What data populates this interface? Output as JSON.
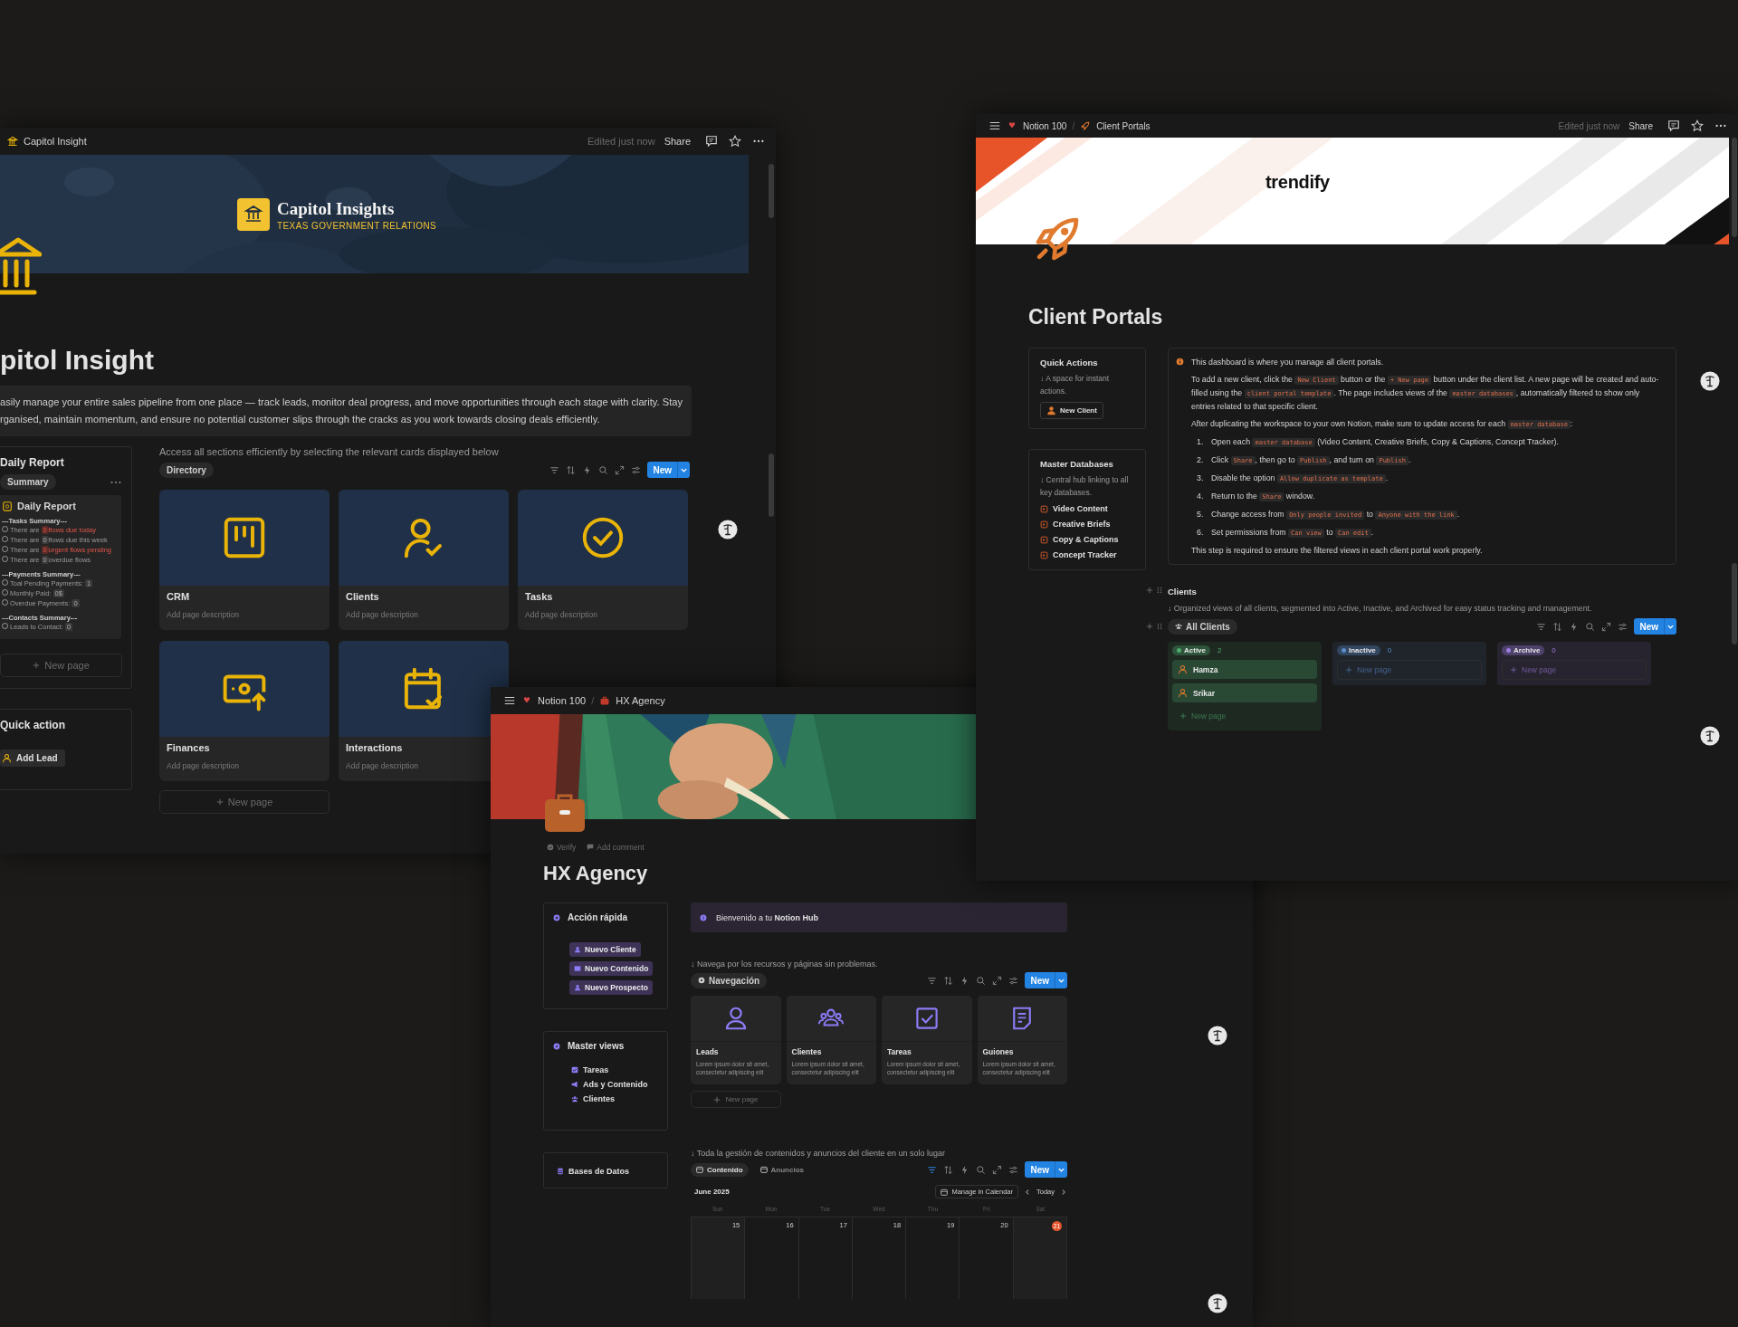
{
  "capitol_window": {
    "breadcrumb": "Capitol Insight",
    "edited": "Edited just now",
    "share": "Share",
    "cover": {
      "brand": "Capitol Insights",
      "tagline": "TEXAS GOVERNMENT RELATIONS"
    },
    "title": "pitol Insight",
    "description": [
      "asily manage your entire sales pipeline from one place — track leads, monitor deal progress, and move opportunities through each stage with clarity. Stay",
      "rganised, maintain momentum, and ensure no potential customer slips through the cracks as you work towards closing deals efficiently."
    ],
    "sidebar": {
      "title": "Daily Report",
      "view": "Summary",
      "report": {
        "title": "Daily Report",
        "sections": [
          {
            "heading": "---Tasks Summary---",
            "lines": [
              {
                "before": "There are",
                "count": "0",
                "after": "flows due today",
                "alert": true
              },
              {
                "before": "There are",
                "count": "0",
                "after": "flows due this week",
                "alert": false
              },
              {
                "before": "There are",
                "count": "0",
                "after": "urgent flows pending",
                "alert": true
              },
              {
                "before": "There are",
                "count": "0",
                "after": "overdue flows",
                "alert": false
              }
            ]
          },
          {
            "heading": "---Payments Summary---",
            "lines": [
              {
                "before": "Toal Pending Payments:",
                "count": "1",
                "alert": false
              },
              {
                "before": "Monthly Paid:",
                "count": "0$",
                "alert": false
              },
              {
                "before": "Overdue Payments:",
                "count": "0",
                "alert": false
              }
            ]
          },
          {
            "heading": "---Contacts Summary---",
            "lines": [
              {
                "before": "Leads to Contact:",
                "count": "0",
                "alert": false
              }
            ]
          }
        ]
      },
      "new_page": "New page"
    },
    "quick_action": {
      "title": "Quick action",
      "button": "Add Lead"
    },
    "main": {
      "hint": "Access all sections efficiently by selecting the relevant cards displayed below",
      "view_tab": "Directory",
      "new_button": "New",
      "cards": [
        {
          "title": "CRM",
          "description": "Add page description"
        },
        {
          "title": "Clients",
          "description": "Add page description"
        },
        {
          "title": "Tasks",
          "description": "Add page description"
        },
        {
          "title": "Finances",
          "description": "Add page description"
        },
        {
          "title": "Interactions",
          "description": "Add page description"
        }
      ],
      "new_page": "New page"
    }
  },
  "client_portals_window": {
    "breadcrumb": [
      "Notion 100",
      "Client Portals"
    ],
    "breadcrumb_separator": "/",
    "edited": "Edited just now",
    "share": "Share",
    "logo": "trendify",
    "title": "Client Portals",
    "quick_actions": {
      "title": "Quick Actions",
      "hint": "↓ A space for instant actions.",
      "button": "New Client"
    },
    "master_databases": {
      "title": "Master Databases",
      "hint": "↓ Central hub linking to all key databases.",
      "links": [
        "Video Content",
        "Creative Briefs",
        "Copy & Captions",
        "Concept Tracker"
      ]
    },
    "callout": {
      "intro": "This dashboard is where you manage all client portals.",
      "paragraphs": [
        [
          {
            "text": "To add a new client, click the "
          },
          {
            "code": "New Client"
          },
          {
            "text": " button or the "
          },
          {
            "code": "+ New page"
          },
          {
            "text": " button under the client list. A new page will be created and auto-filled using the "
          },
          {
            "code": "client portal template"
          },
          {
            "text": ". The page includes views of the "
          },
          {
            "code": "master databases"
          },
          {
            "text": ", automatically filtered to show only entries related to that specific client."
          }
        ],
        [
          {
            "text": "After duplicating the workspace to your own Notion, make sure to update access for each "
          },
          {
            "code": "master database"
          },
          {
            "text": ":"
          }
        ]
      ],
      "steps": [
        {
          "number": "1.",
          "parts": [
            {
              "text": "Open each "
            },
            {
              "code": "master database"
            },
            {
              "text": " (Video Content, Creative Briefs, Copy & Captions, Concept Tracker)."
            }
          ]
        },
        {
          "number": "2.",
          "parts": [
            {
              "text": "Click "
            },
            {
              "code": "Share"
            },
            {
              "text": ", then go to "
            },
            {
              "code": "Publish"
            },
            {
              "text": ", and turn on "
            },
            {
              "code": "Publish"
            },
            {
              "text": "."
            }
          ]
        },
        {
          "number": "3.",
          "parts": [
            {
              "text": "Disable the option "
            },
            {
              "code": "Allow duplicate as template"
            },
            {
              "text": "."
            }
          ]
        },
        {
          "number": "4.",
          "parts": [
            {
              "text": "Return to the "
            },
            {
              "code": "Share"
            },
            {
              "text": " window."
            }
          ]
        },
        {
          "number": "5.",
          "parts": [
            {
              "text": "Change access from "
            },
            {
              "code": "Only people invited"
            },
            {
              "text": " to "
            },
            {
              "code": "Anyone with the link"
            },
            {
              "text": "."
            }
          ]
        },
        {
          "number": "6.",
          "parts": [
            {
              "text": "Set permissions from "
            },
            {
              "code": "Can view"
            },
            {
              "text": " to "
            },
            {
              "code": "Can edit"
            },
            {
              "text": "."
            }
          ]
        }
      ],
      "outro": "This step is required to ensure the filtered views in each client portal work properly."
    },
    "clients": {
      "heading": "Clients",
      "description": "↓ Organized views of all clients, segmented into Active, Inactive, and Archived for easy status tracking and management.",
      "view_tab": "All Clients",
      "new_button": "New",
      "groups": [
        {
          "name": "Active",
          "count": "2",
          "color": "#4dab6f",
          "items": [
            "Hamza",
            "Srikar"
          ],
          "new_page": "New page"
        },
        {
          "name": "Inactive",
          "count": "0",
          "color": "#5b8bc9",
          "new_page": "New page"
        },
        {
          "name": "Archive",
          "count": "0",
          "color": "#9d7ce0",
          "new_page": "New page"
        }
      ]
    }
  },
  "hx_window": {
    "breadcrumb": [
      "Notion 100",
      "HX Agency"
    ],
    "breadcrumb_separator": "/",
    "meta": [
      "Verify",
      "Add comment"
    ],
    "title": "HX Agency",
    "quick_action": {
      "title": "Acción rápida",
      "buttons": [
        "Nuevo Cliente",
        "Nuevo Contenido",
        "Nuevo Prospecto"
      ]
    },
    "master_views": {
      "title": "Master views",
      "links": [
        "Tareas",
        "Ads y Contenido",
        "Clientes"
      ]
    },
    "databases": {
      "title": "Bases de Datos"
    },
    "callout": "Bienvenido a tu **Notion Hub**",
    "nav_hint": "↓ Navega por los recursos y páginas sin problemas.",
    "nav_tab": "Navegación",
    "new_button": "New",
    "cards": [
      {
        "title": "Leads",
        "description": "Lorem ipsum dolor sit amet, consectetur adipiscing elit"
      },
      {
        "title": "Clientes",
        "description": "Lorem ipsum dolor sit amet, consectetur adipiscing elit"
      },
      {
        "title": "Tareas",
        "description": "Lorem ipsum dolor sit amet, consectetur adipiscing elit"
      },
      {
        "title": "Guiones",
        "description": "Lorem ipsum dolor sit amet, consectetur adipiscing elit"
      }
    ],
    "new_page": "New page",
    "content_hint": "↓ Toda la gestión de contenidos y anuncios del cliente en un solo lugar",
    "content_tabs": [
      {
        "label": "Contenido",
        "selected": true
      },
      {
        "label": "Anuncios",
        "selected": false
      }
    ],
    "content_new_button": "New",
    "calendar": {
      "month": "June 2025",
      "manage": "Manage in Calendar",
      "today": "Today",
      "weekdays": [
        "Sun",
        "Mon",
        "Tue",
        "Wed",
        "Thu",
        "Fri",
        "Sat"
      ],
      "days": [
        {
          "label": "15",
          "today": false
        },
        {
          "label": "16",
          "today": false
        },
        {
          "label": "17",
          "today": false
        },
        {
          "label": "18",
          "today": false
        },
        {
          "label": "19",
          "today": false
        },
        {
          "label": "20",
          "today": false
        },
        {
          "label": "21",
          "today": true
        }
      ]
    }
  }
}
